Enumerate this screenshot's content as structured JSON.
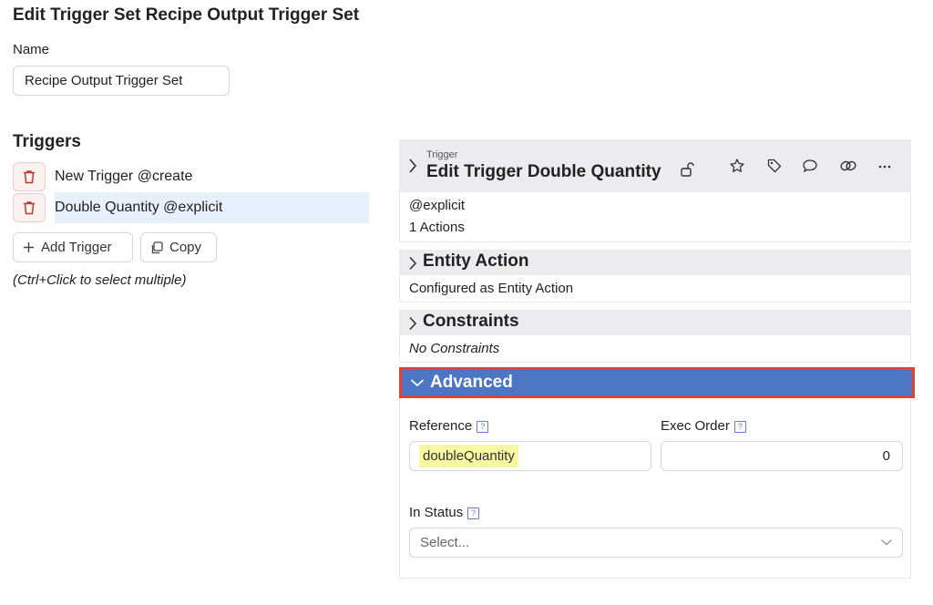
{
  "page": {
    "title": "Edit Trigger Set Recipe Output Trigger Set",
    "name_label": "Name",
    "name_value": "Recipe Output Trigger Set"
  },
  "triggers": {
    "heading": "Triggers",
    "items": [
      {
        "label": "New Trigger @create",
        "selected": false
      },
      {
        "label": "Double Quantity @explicit",
        "selected": true
      }
    ],
    "add_label": "Add Trigger",
    "copy_label": "Copy",
    "hint": "(Ctrl+Click to select multiple)"
  },
  "panel": {
    "small_label": "Trigger",
    "title": "Edit Trigger Double Quantity",
    "meta_event": "@explicit",
    "meta_actions": "1 Actions",
    "icons": [
      "unlock-icon",
      "star-icon",
      "tag-icon",
      "comment-icon",
      "link-icon",
      "more-icon"
    ],
    "entity_action": {
      "title": "Entity Action",
      "body": "Configured as Entity Action"
    },
    "constraints": {
      "title": "Constraints",
      "body": "No Constraints"
    },
    "advanced": {
      "title": "Advanced",
      "reference_label": "Reference",
      "reference_value": "doubleQuantity",
      "exec_order_label": "Exec Order",
      "exec_order_value": "0",
      "in_status_label": "In Status",
      "in_status_placeholder": "Select...",
      "help_glyph": "?"
    }
  },
  "colors": {
    "advanced_bg": "#4c75c4",
    "highlight_border": "#e0452b",
    "selected_row": "#e8f1fb",
    "reference_highlight": "#f8f8a0",
    "delete_icon": "#c0392b"
  }
}
